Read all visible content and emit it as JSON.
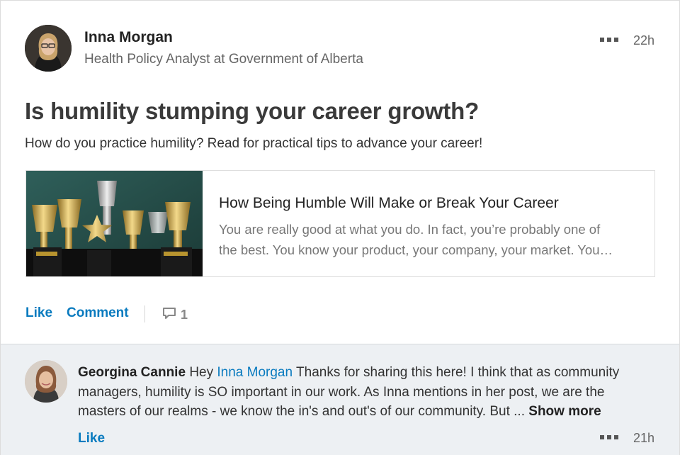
{
  "post": {
    "author_name": "Inna Morgan",
    "author_headline": "Health Policy Analyst at Government of Alberta",
    "time": "22h",
    "title": "Is humility stumping your career growth?",
    "text": "How do you practice humility? Read for practical tips to advance your career!",
    "article": {
      "title": "How Being Humble Will Make or Break Your Career",
      "description_line1": "You are really good at what you do. In fact, you’re probably one of",
      "description_line2": "the best. You know your product, your company, your market. You…",
      "thumbnail_icon": "trophies-image"
    },
    "actions": {
      "like_label": "Like",
      "comment_label": "Comment",
      "comment_count": "1"
    }
  },
  "comment": {
    "author_name": "Georgina Cannie",
    "prefix": "Hey",
    "mention": "Inna Morgan",
    "line1_rest": "Thanks for sharing this here! I think that as community",
    "line2": "managers, humility is SO important in our work. As Inna mentions in her post, we are the",
    "line3": "masters of our realms - we know the in's and out's of our community. But ...",
    "show_more": "Show more",
    "like_label": "Like",
    "time": "21h"
  },
  "colors": {
    "link": "#0a7bbf",
    "comment_bg": "#edf0f3"
  }
}
